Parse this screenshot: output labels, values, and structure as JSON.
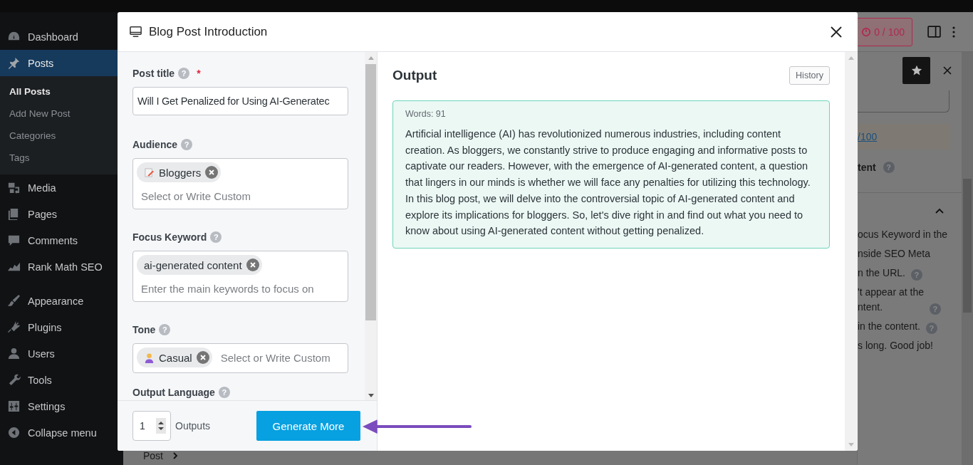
{
  "sidebar": {
    "items": [
      {
        "label": "Dashboard",
        "selected": false
      },
      {
        "label": "Posts",
        "selected": true,
        "children": [
          {
            "label": "All Posts",
            "selected": true
          },
          {
            "label": "Add New Post",
            "selected": false
          },
          {
            "label": "Categories",
            "selected": false
          },
          {
            "label": "Tags",
            "selected": false
          }
        ]
      },
      {
        "label": "Media",
        "selected": false
      },
      {
        "label": "Pages",
        "selected": false
      },
      {
        "label": "Comments",
        "selected": false
      },
      {
        "label": "Rank Math SEO",
        "selected": false
      },
      {
        "label": "Appearance",
        "selected": false
      },
      {
        "label": "Plugins",
        "selected": false
      },
      {
        "label": "Users",
        "selected": false
      },
      {
        "label": "Tools",
        "selected": false
      },
      {
        "label": "Settings",
        "selected": false
      },
      {
        "label": "Collapse menu",
        "selected": false
      }
    ]
  },
  "editor": {
    "score": "0 / 100",
    "score_link": "/100",
    "section_title": "tent",
    "checks": [
      {
        "text": "ocus Keyword in the"
      },
      {
        "text": "nside SEO Meta"
      },
      {
        "text": "n the URL.",
        "help": "?"
      },
      {
        "text": "'t appear at the\nntent.",
        "help": "?"
      },
      {
        "text": "in the content.",
        "help": "?"
      },
      {
        "text": "s long. Good job!"
      }
    ],
    "section_help": "?",
    "breadcrumb": "Post"
  },
  "modal": {
    "title": "Blog Post Introduction",
    "fields": [
      {
        "kind": "text",
        "label": "Post title",
        "help": "?",
        "required_mark": "*",
        "value": "Will I Get Penalized for Using AI-Generatec"
      },
      {
        "kind": "taglist",
        "label": "Audience",
        "help": "?",
        "tags": [
          {
            "label": "Bloggers"
          }
        ],
        "placeholder": "Select or Write Custom"
      },
      {
        "kind": "taglist",
        "label": "Focus Keyword",
        "help": "?",
        "tags": [
          {
            "label": "ai-generated content"
          }
        ],
        "placeholder": "Enter the main keywords to focus on"
      },
      {
        "kind": "tagrow",
        "label": "Tone",
        "help": "?",
        "tags": [
          {
            "label": "Casual"
          }
        ],
        "placeholder": "Select or Write Custom"
      },
      {
        "kind": "label",
        "label": "Output Language",
        "help": "?"
      }
    ],
    "outputs": {
      "value": "1",
      "label": "Outputs"
    },
    "generate_button": "Generate More",
    "output": {
      "heading": "Output",
      "history_button": "History",
      "words": "Words: 91",
      "text": "Artificial intelligence (AI) has revolutionized numerous industries, including content creation. As bloggers, we constantly strive to produce engaging and informative posts to captivate our readers. However, with the emergence of AI-generated content, a question that lingers in our minds is whether we will face any penalties for utilizing this technology. In this blog post, we will delve into the controversial topic of AI-generated content and explore its implications for bloggers. So, let's dive right in and find out what you need to know about using AI-generated content without getting penalized."
    }
  }
}
